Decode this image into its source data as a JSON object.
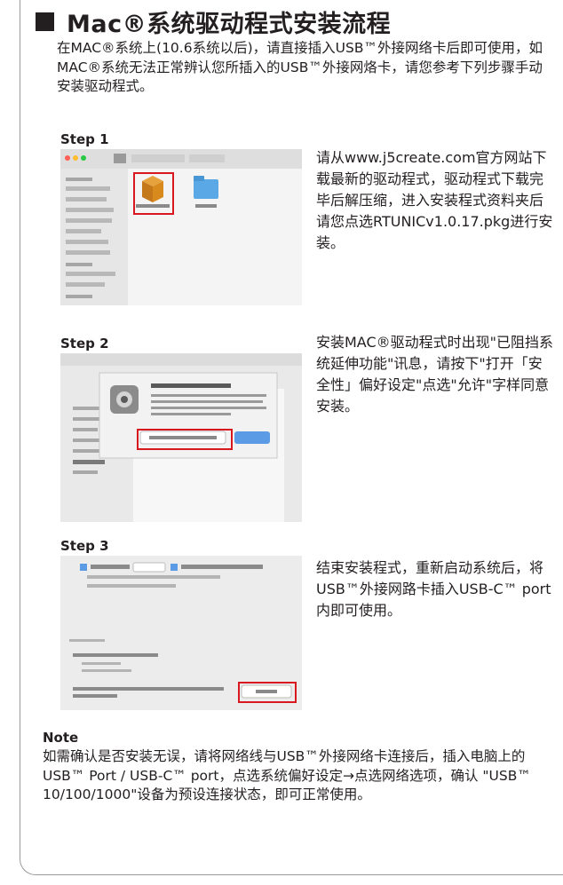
{
  "title": "Mac®系统驱动程式安装流程",
  "intro": "在MAC®系统上(10.6系统以后)，请直接插入USB™外接网络卡后即可使用，如MAC®系统无法正常辨认您所插入的USB™外接网烙卡，请您参考下列步骤手动安装驱动程式。",
  "steps": [
    {
      "label": "Step 1",
      "description": "请从www.j5create.com官方网站下载最新的驱动程式，驱动程式下载完毕后解压缩，进入安装程式资料夹后请您点选RTUNICv1.0.17.pkg进行安装。"
    },
    {
      "label": "Step 2",
      "description": "安装MAC®驱动程式时出现\"已阻挡系统延伸功能\"讯息，请按下\"打开「安全性」偏好设定\"点选\"允许\"字样同意安装。"
    },
    {
      "label": "Step 3",
      "description": "结束安装程式，重新启动系统后，将USB™外接网路卡插入USB-C™ port内即可使用。"
    }
  ],
  "note": {
    "label": "Note",
    "text": "如需确认是否安装无误，请将网络线与USB™外接网络卡连接后，插入电脑上的USB™ Port / USB-C™ port，点选系统偏好设定→点选网络选项，确认 \"USB™ 10/100/1000\"设备为预设连接状态，即可正常使用。"
  },
  "colors": {
    "text": "#231f20",
    "highlight_box": "#d7191f",
    "folder": "#5aa9e6",
    "package": "#d98a1c",
    "allow_button": "#5b9be6"
  },
  "icons": [
    "package-icon",
    "folder-icon",
    "extension-shield-icon"
  ]
}
